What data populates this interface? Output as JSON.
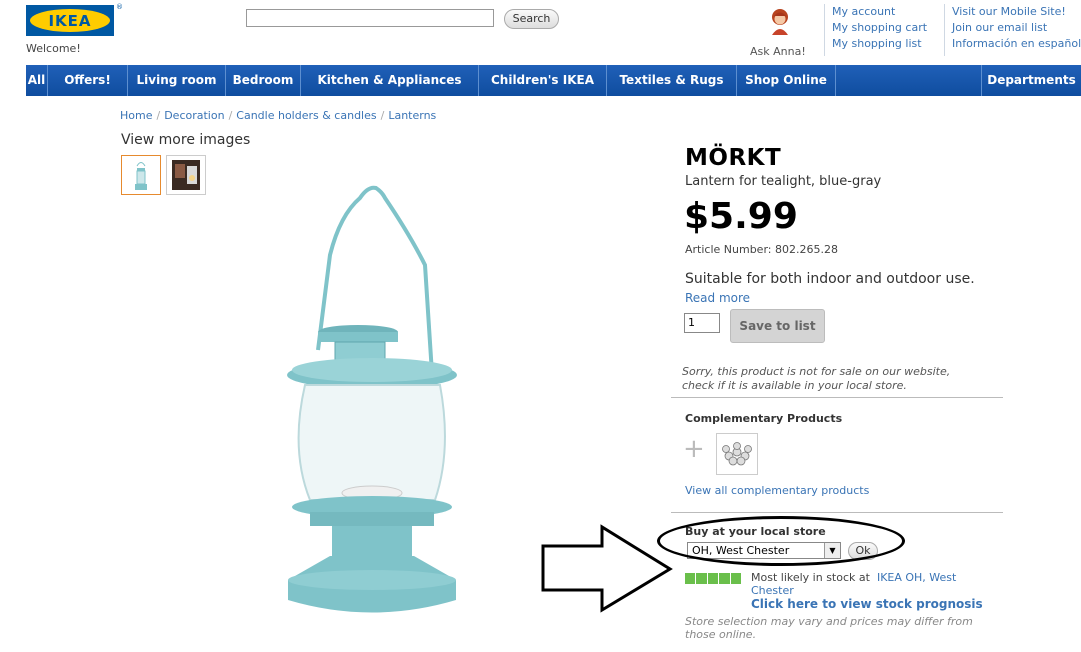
{
  "header": {
    "logo_text": "IKEA",
    "logo_reg": "®",
    "welcome": "Welcome!",
    "search_button": "Search",
    "search_placeholder": "",
    "ask_anna": "Ask Anna!",
    "links_col1": [
      "My account",
      "My shopping cart",
      "My shopping list"
    ],
    "links_col2": [
      "Visit our Mobile Site!",
      "Join our email list",
      "Información en español"
    ]
  },
  "nav": {
    "items": [
      "All",
      "Offers!",
      "Living room",
      "Bedroom",
      "Kitchen & Appliances",
      "Children's IKEA",
      "Textiles & Rugs",
      "Shop Online",
      "Departments"
    ]
  },
  "breadcrumb": [
    "Home",
    "Decoration",
    "Candle holders & candles",
    "Lanterns"
  ],
  "gallery": {
    "label": "View more images"
  },
  "product": {
    "name": "MÖRKT",
    "subtitle": "Lantern for tealight, blue-gray",
    "price": "$5.99",
    "article": "Article Number: 802.265.28",
    "description": "Suitable for both indoor and outdoor use.",
    "read_more": "Read more",
    "quantity": "1",
    "save_button": "Save to list",
    "not_for_sale": "Sorry, this product is not for sale on our website, check if it is available in your local store."
  },
  "complementary": {
    "title": "Complementary Products",
    "plus": "+",
    "view_all": "View all complementary products"
  },
  "local_store": {
    "title": "Buy at your local store",
    "selected_store": "OH, West Chester",
    "ok_button": "Ok",
    "stock_level": 1.0,
    "stock_text": "Most likely in stock at",
    "stock_store_link": "IKEA OH, West Chester",
    "prognosis_link": "Click here to view stock prognosis",
    "note": "Store selection may vary and prices may differ from those online."
  },
  "colors": {
    "nav_blue": "#0f4d9f",
    "link_blue": "#3a74b5",
    "lantern": "#7fc3c9",
    "stock_green": "#6abf4b",
    "thumb_border_active": "#e68a2e"
  }
}
